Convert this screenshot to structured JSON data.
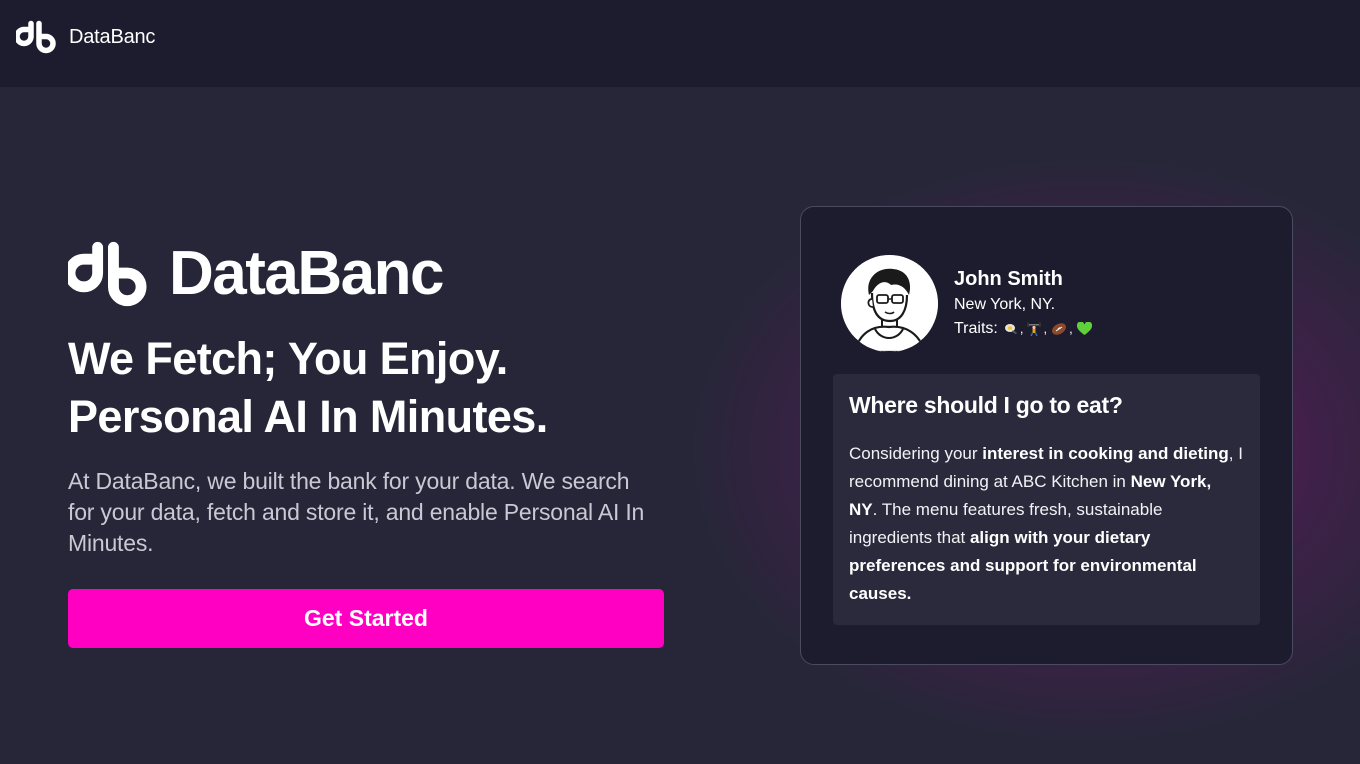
{
  "topbar": {
    "brand_name": "DataBanc",
    "logo_icon": "databanc-logo-icon"
  },
  "hero": {
    "brand_name": "DataBanc",
    "headline_line1": "We Fetch; You Enjoy.",
    "headline_line2": "Personal AI In Minutes.",
    "lead": "At DataBanc, we built the bank for your data. We search for your data, fetch and store it, and enable Personal AI In Minutes.",
    "cta_label": "Get Started"
  },
  "colors": {
    "background": "#262638",
    "topbar": "#1c1c2e",
    "accent": "#ff00c3",
    "card": "#1c1c2e",
    "answer_panel": "#2a2a3c"
  },
  "card": {
    "profile": {
      "name": "John Smith",
      "location": "New York, NY.",
      "traits_label": "Traits:",
      "traits": [
        "cooking-icon",
        "weightlifting-icon",
        "football-icon",
        "green-heart-icon"
      ],
      "trait_separator": ","
    },
    "question": "Where should I go to eat?",
    "answer": {
      "t1": "Considering your ",
      "b1": "interest in cooking and dieting",
      "t2": ", I recommend dining at ABC Kitchen in ",
      "b2": "New York, NY",
      "t3": ". The menu features fresh, sustainable ingredients that ",
      "b3": "align with your dietary preferences and support for environmental causes."
    }
  }
}
